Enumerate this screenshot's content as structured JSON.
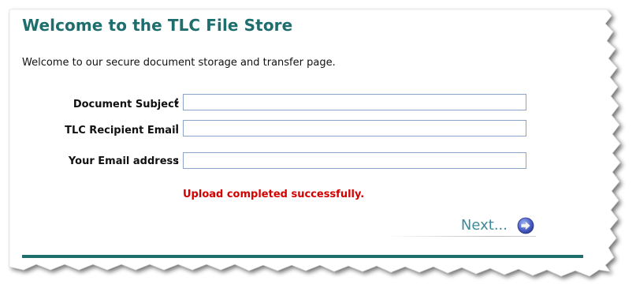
{
  "page": {
    "title": "Welcome to the TLC File Store",
    "intro": "Welcome to our secure document storage and transfer page."
  },
  "form": {
    "fields": [
      {
        "label": "Document Subject",
        "colon": ":",
        "value": ""
      },
      {
        "label": "TLC Recipient Email",
        "colon": ":",
        "value": ""
      },
      {
        "label": "Your Email address",
        "colon": ":",
        "value": ""
      }
    ],
    "status_message": "Upload completed successfully.",
    "next_label": "Next..."
  },
  "colors": {
    "title": "#1f6e6e",
    "status": "#d40000",
    "next": "#3d8a9b",
    "input_border": "#8aa4c8"
  },
  "icons": {
    "next": "arrow-right-circle-icon"
  }
}
